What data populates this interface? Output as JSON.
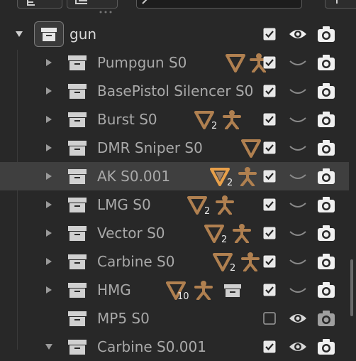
{
  "collection": {
    "name": "gun"
  },
  "rows": [
    {
      "name": "Pumpgun S0"
    },
    {
      "name": "BasePistol Silencer S0"
    },
    {
      "name": "Burst S0",
      "count": "2"
    },
    {
      "name": "DMR Sniper S0"
    },
    {
      "name": "AK S0.001",
      "count": "2"
    },
    {
      "name": "LMG S0",
      "count": "2"
    },
    {
      "name": "Vector S0",
      "count": "2"
    },
    {
      "name": "Carbine S0",
      "count": "2"
    },
    {
      "name": "HMG",
      "count": "10"
    },
    {
      "name": "MP5 S0"
    },
    {
      "name": "Carbine S0.001"
    }
  ],
  "colors": {
    "accent": "#e8a04a",
    "modifier": "#b08050",
    "selected": "#3f3f3f"
  }
}
